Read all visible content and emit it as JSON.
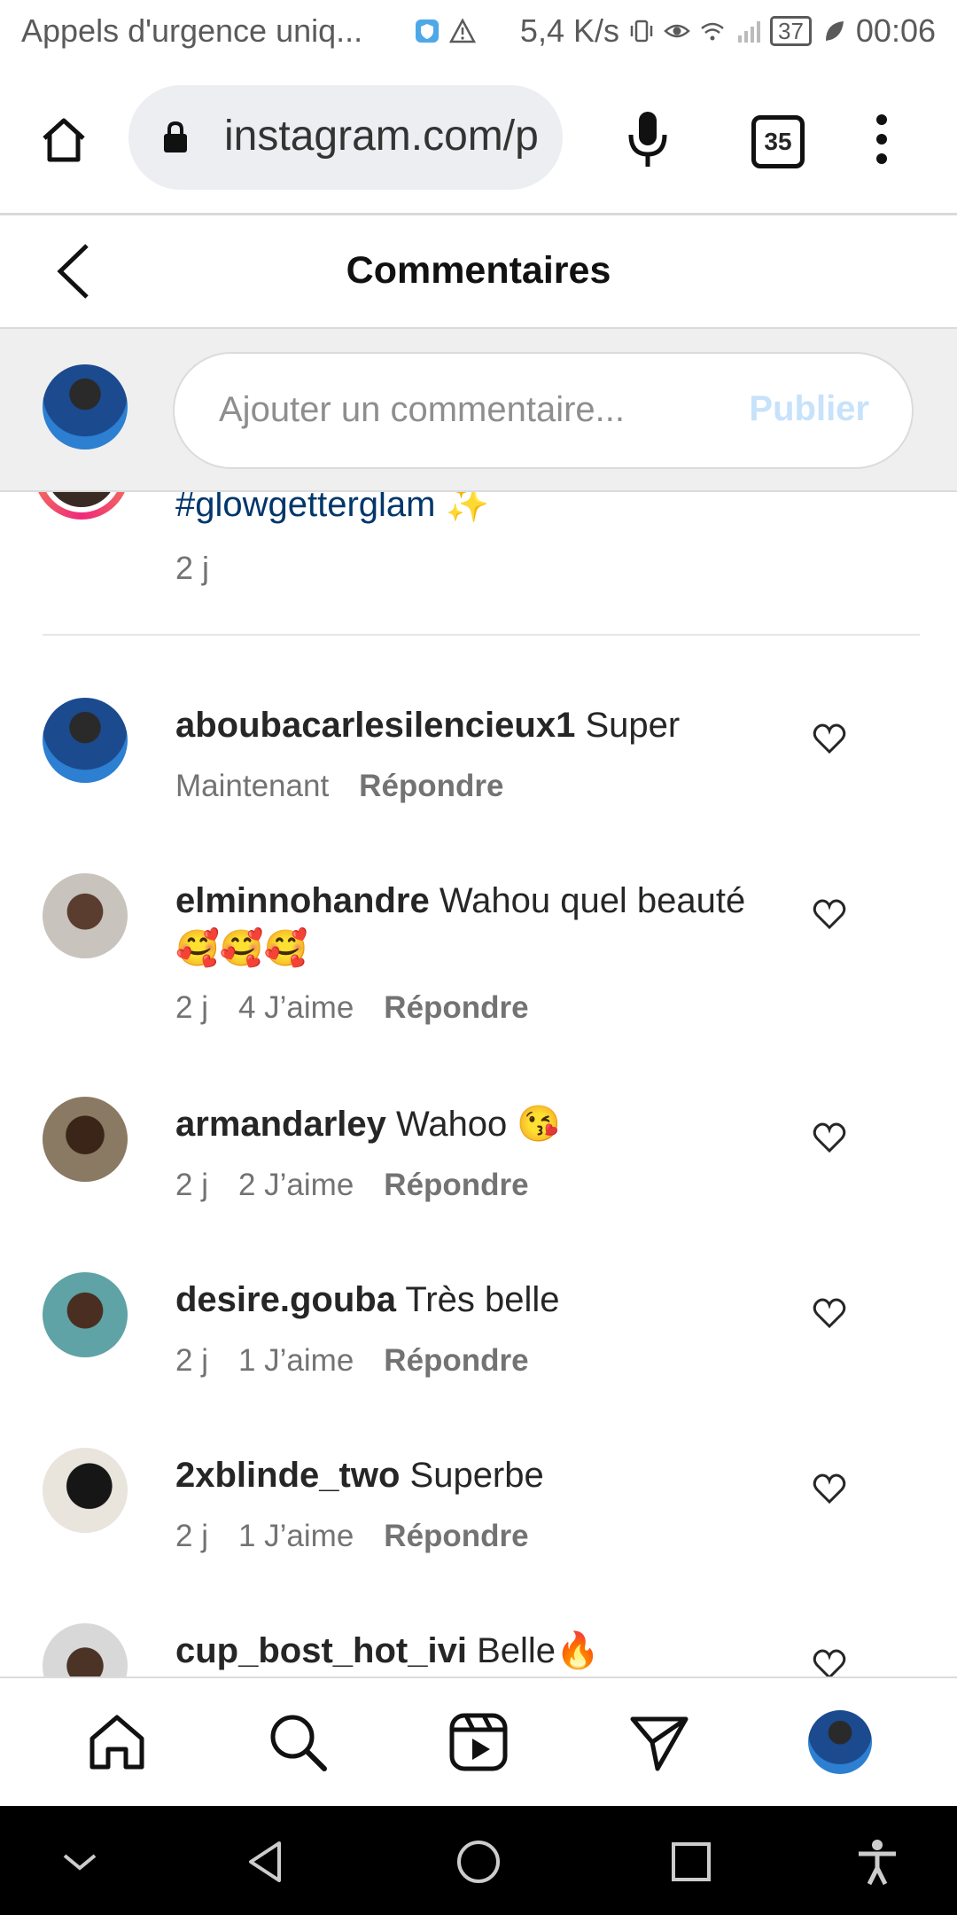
{
  "status_bar": {
    "notification": "Appels d'urgence uniq...",
    "speed": "5,4 K/s",
    "battery": "37",
    "time": "00:06"
  },
  "browser": {
    "url": "instagram.com/p",
    "tab_count": "35"
  },
  "header": {
    "title": "Commentaires"
  },
  "comment_input": {
    "placeholder": "Ajouter un commentaire...",
    "publish_label": "Publier"
  },
  "caption": {
    "hashtag": "#glowgetterglam ✨",
    "time": "2 j"
  },
  "comments": [
    {
      "user": "aboubacarlesilencieux1",
      "text": "Super",
      "time": "Maintenant",
      "likes": "",
      "reply": "Répondre"
    },
    {
      "user": "elminnohandre",
      "text": "Wahou quel beauté 🥰🥰🥰",
      "time": "2 j",
      "likes": "4 J’aime",
      "reply": "Répondre"
    },
    {
      "user": "armandarley",
      "text": "Wahoo 😘",
      "time": "2 j",
      "likes": "2 J’aime",
      "reply": "Répondre"
    },
    {
      "user": "desire.gouba",
      "text": "Très belle",
      "time": "2 j",
      "likes": "1 J’aime",
      "reply": "Répondre"
    },
    {
      "user": "2xblinde_two",
      "text": "Superbe",
      "time": "2 j",
      "likes": "1 J’aime",
      "reply": "Répondre"
    },
    {
      "user": "cup_bost_hot_ivi",
      "text": "Belle🔥",
      "time": "",
      "likes": "",
      "reply": ""
    }
  ],
  "icons": {
    "home": "home-icon",
    "search": "search-icon",
    "reels": "reels-icon",
    "direct": "direct-icon",
    "heart": "heart-icon",
    "mic": "mic-icon",
    "menu": "more-vert-icon"
  },
  "colors": {
    "link": "#00376b",
    "publish_disabled": "#c7e2fb",
    "meta_text": "#737373"
  }
}
